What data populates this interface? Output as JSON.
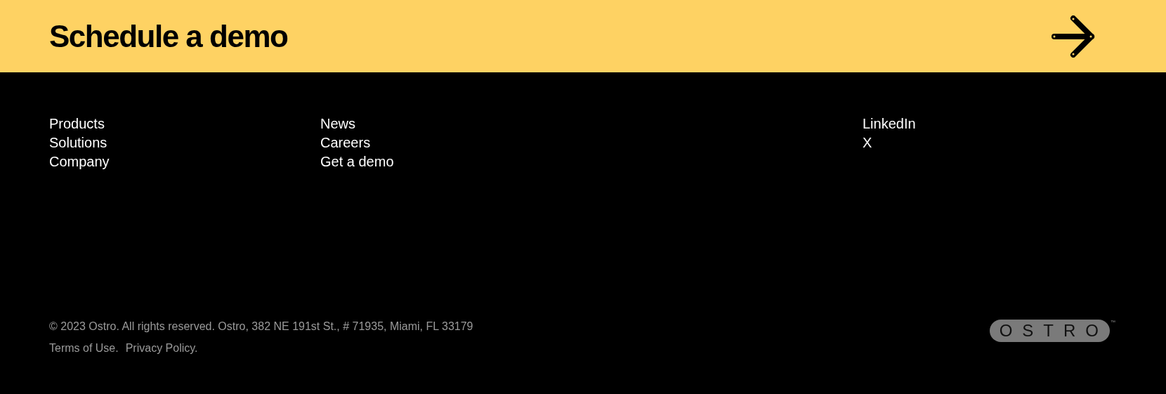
{
  "banner": {
    "title": "Schedule a demo"
  },
  "link_columns": [
    [
      "Products",
      "Solutions",
      "Company"
    ],
    [
      "News",
      "Careers",
      "Get a demo"
    ],
    [
      "LinkedIn",
      "X"
    ]
  ],
  "copyright": "© 2023 Ostro. All rights reserved. Ostro, 382 NE 191st St., # 71935, Miami, FL 33179",
  "legal_links": [
    "Terms of Use.",
    "Privacy Policy."
  ],
  "logo": {
    "text": "OSTRO",
    "mark": "™"
  }
}
